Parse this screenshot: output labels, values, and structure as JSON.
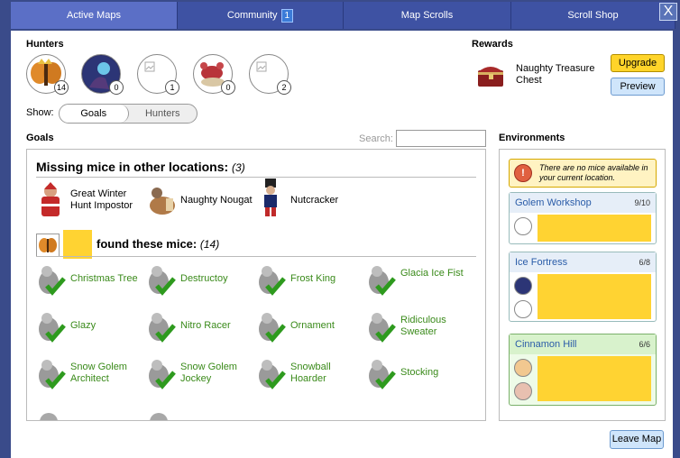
{
  "tabs": [
    {
      "label": "Active Maps"
    },
    {
      "label": "Community",
      "badge": "1"
    },
    {
      "label": "Map Scrolls"
    },
    {
      "label": "Scroll Shop"
    }
  ],
  "close_label": "X",
  "hunters": {
    "title": "Hunters",
    "items": [
      {
        "icon": "hunter-moth-icon",
        "count": "14"
      },
      {
        "icon": "hunter-mage-icon",
        "count": "0"
      },
      {
        "icon": "hunter-placeholder-icon",
        "count": "1"
      },
      {
        "icon": "hunter-crab-icon",
        "count": "0"
      },
      {
        "icon": "hunter-placeholder-icon",
        "count": "2"
      }
    ]
  },
  "rewards": {
    "title": "Rewards",
    "item": "Naughty Treasure Chest",
    "upgrade_label": "Upgrade",
    "preview_label": "Preview"
  },
  "show": {
    "label": "Show:",
    "options": [
      "Goals",
      "Hunters"
    ],
    "selected": "Goals"
  },
  "goals": {
    "title": "Goals",
    "search_label": "Search:",
    "search_value": "",
    "missing_heading": "Missing mice in other locations:",
    "missing_count": "(3)",
    "missing": [
      "Great Winter Hunt Impostor",
      "Naughty Nougat",
      "Nutcracker"
    ],
    "found_heading": "found these mice:",
    "found_count": "(14)",
    "found": [
      "Christmas Tree",
      "Destructoy",
      "Frost King",
      "Glacia Ice Fist",
      "Glazy",
      "Nitro Racer",
      "Ornament",
      "Ridiculous Sweater",
      "Snow Golem Architect",
      "Snow Golem Jockey",
      "Snowball Hoarder",
      "Stocking"
    ]
  },
  "environments": {
    "title": "Environments",
    "notice": "There are no mice available in your current location.",
    "items": [
      {
        "name": "Golem Workshop",
        "count": "9/10"
      },
      {
        "name": "Ice Fortress",
        "count": "6/8"
      },
      {
        "name": "Cinnamon Hill",
        "count": "6/6"
      }
    ]
  },
  "leave_label": "Leave Map",
  "colors": {
    "tab_bg": "#3e52a3",
    "tab_active": "#5b6fc6",
    "found_green": "#3a8a1a",
    "env_link": "#2a5ca8",
    "highlight_yellow": "#ffd332"
  }
}
